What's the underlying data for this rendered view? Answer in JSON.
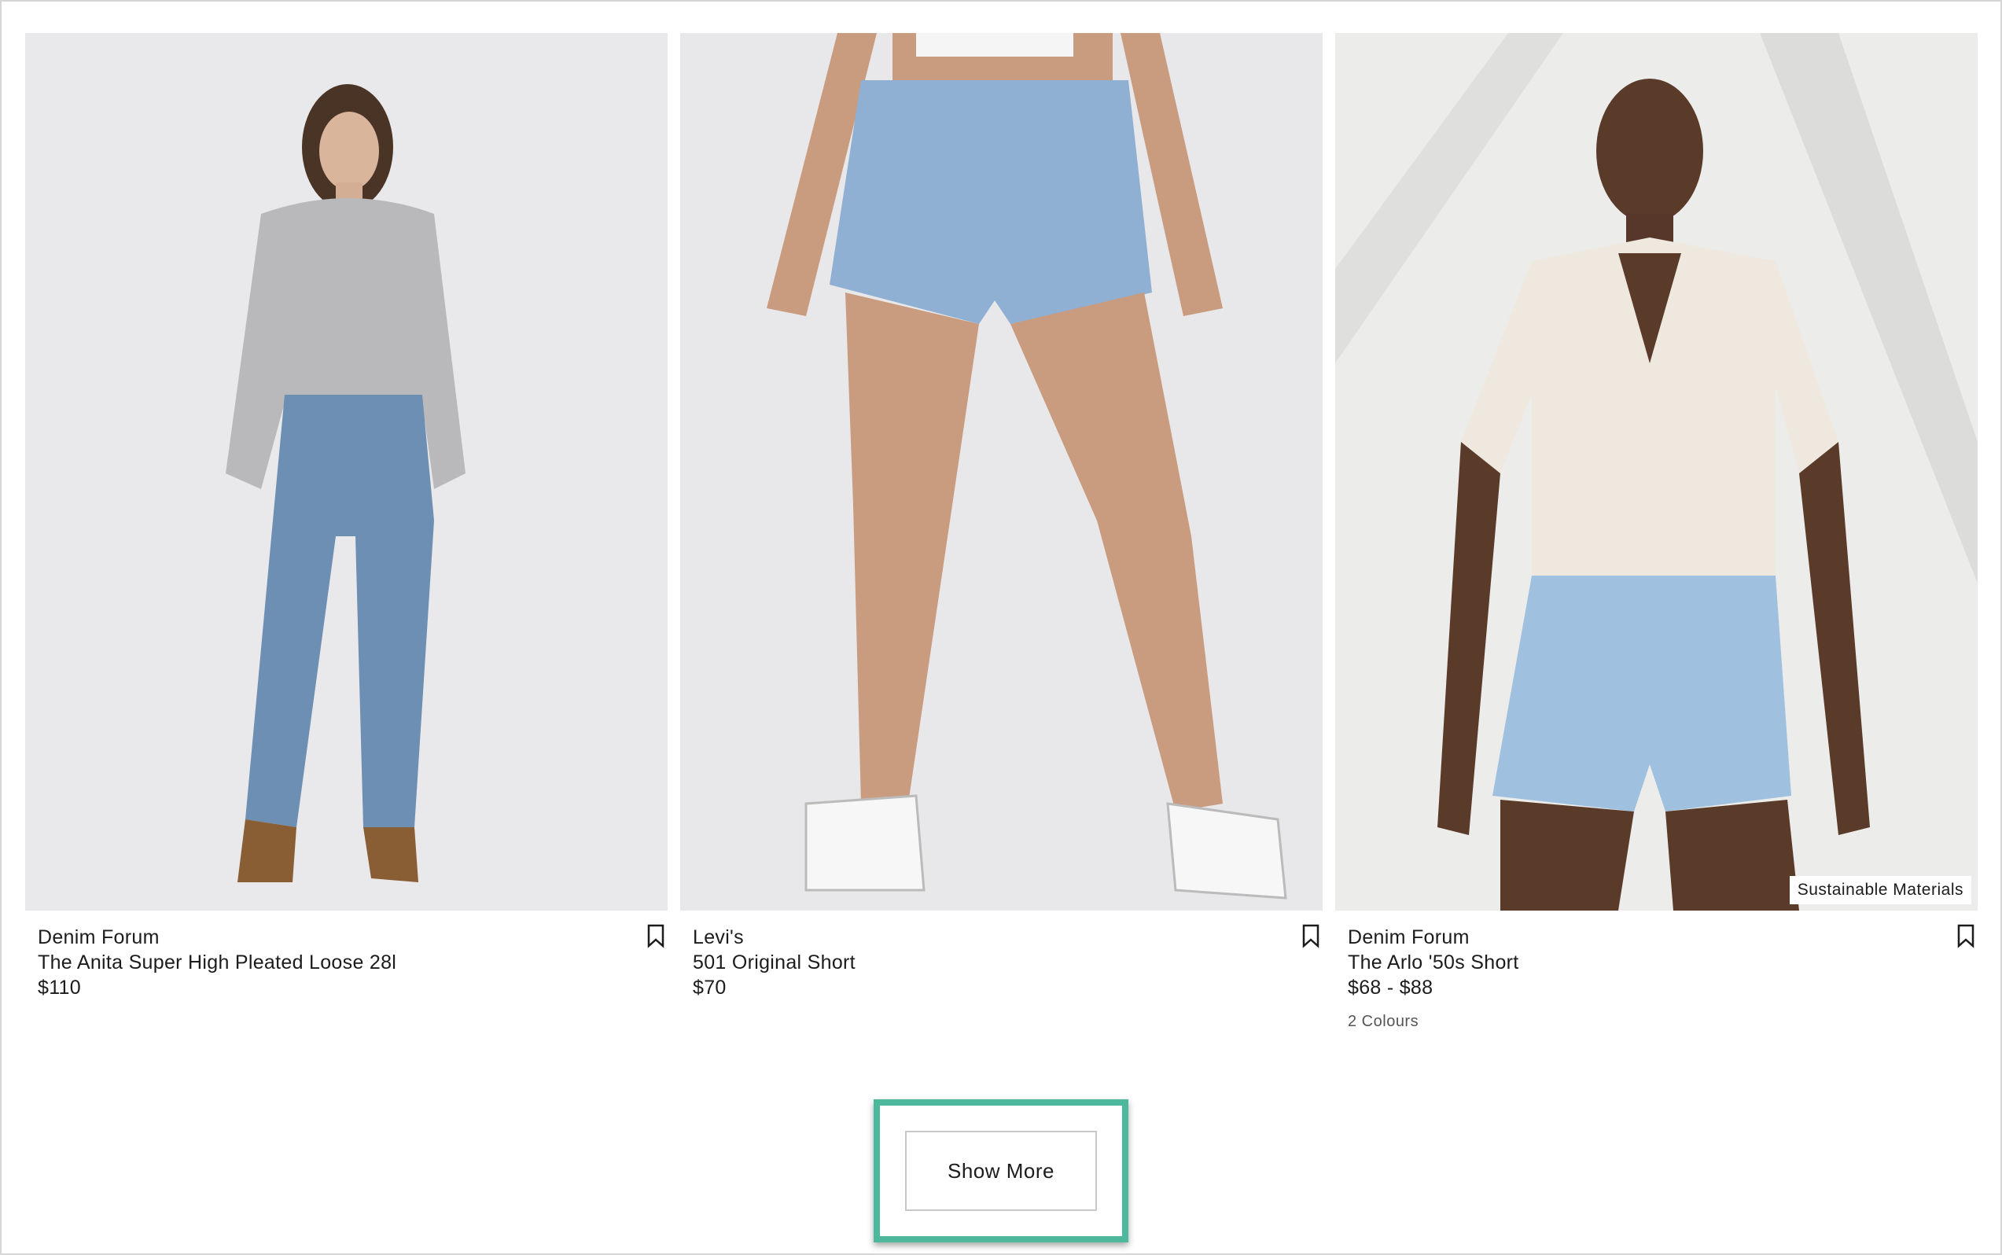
{
  "products": [
    {
      "brand": "Denim Forum",
      "title": "The Anita Super High Pleated Loose 28l",
      "price": "$110",
      "image_alt": "Model wearing grey sweatshirt and light blue loose jeans"
    },
    {
      "brand": "Levi's",
      "title": "501 Original Short",
      "price": "$70",
      "image_alt": "Model wearing distressed denim shorts and white sneakers"
    },
    {
      "brand": "Denim Forum",
      "title": "The Arlo '50s Short",
      "price": "$68 - $88",
      "colours": "2 Colours",
      "badge": "Sustainable Materials",
      "image_alt": "Model wearing white shirt and light denim shorts"
    }
  ],
  "show_more": {
    "label": "Show More"
  },
  "colors": {
    "highlight": "#4db89c",
    "border": "#c8c8c8",
    "text": "#1c1c1c"
  },
  "icons": {
    "bookmark": "bookmark-icon"
  }
}
